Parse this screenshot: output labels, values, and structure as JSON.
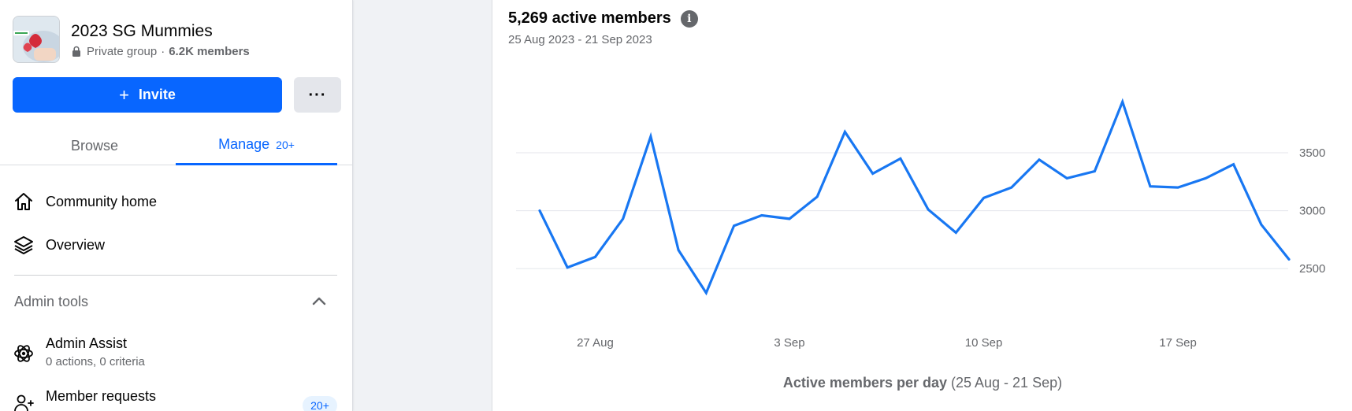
{
  "sidebar": {
    "group": {
      "name": "2023 SG Mummies",
      "privacy": "Private group",
      "separator": "·",
      "members": "6.2K members"
    },
    "invite_label": "Invite",
    "more_label": "···",
    "tabs": [
      {
        "label": "Browse"
      },
      {
        "label": "Manage",
        "badge": "20+"
      }
    ],
    "nav": [
      {
        "label": "Community home",
        "icon": "home-icon"
      },
      {
        "label": "Overview",
        "icon": "layers-icon"
      }
    ],
    "admin_tools": {
      "title": "Admin tools",
      "items": [
        {
          "name": "Admin Assist",
          "sub": "0 actions, 0 criteria",
          "icon": "admin-assist-icon"
        },
        {
          "name": "Member requests",
          "badge": "20+",
          "icon": "member-requests-icon"
        }
      ]
    }
  },
  "card": {
    "title": "5,269 active members",
    "subtitle": "25 Aug 2023 - 21 Sep 2023",
    "caption_bold": "Active members per day",
    "caption_rest": " (25 Aug - 21 Sep)"
  },
  "colors": {
    "accent": "#0866ff",
    "line": "#1877f2",
    "grid": "#e4e6eb",
    "muted": "#65676b"
  },
  "chart_data": {
    "type": "line",
    "x": [
      "25 Aug",
      "26 Aug",
      "27 Aug",
      "28 Aug",
      "29 Aug",
      "30 Aug",
      "31 Aug",
      "1 Sep",
      "2 Sep",
      "3 Sep",
      "4 Sep",
      "5 Sep",
      "6 Sep",
      "7 Sep",
      "8 Sep",
      "9 Sep",
      "10 Sep",
      "11 Sep",
      "12 Sep",
      "13 Sep",
      "14 Sep",
      "15 Sep",
      "16 Sep",
      "17 Sep",
      "18 Sep",
      "19 Sep",
      "20 Sep",
      "21 Sep"
    ],
    "values": [
      3000,
      2510,
      2600,
      2930,
      3640,
      2660,
      2290,
      2870,
      2960,
      2930,
      3120,
      3680,
      3320,
      3450,
      3010,
      2810,
      3110,
      3200,
      3440,
      3280,
      3340,
      3940,
      3210,
      3200,
      3280,
      3400,
      2880,
      2580
    ],
    "x_ticks": [
      "27 Aug",
      "3 Sep",
      "10 Sep",
      "17 Sep"
    ],
    "y_ticks": [
      2500,
      3000,
      3500
    ],
    "ylim": [
      2100,
      4200
    ],
    "grid": true
  }
}
